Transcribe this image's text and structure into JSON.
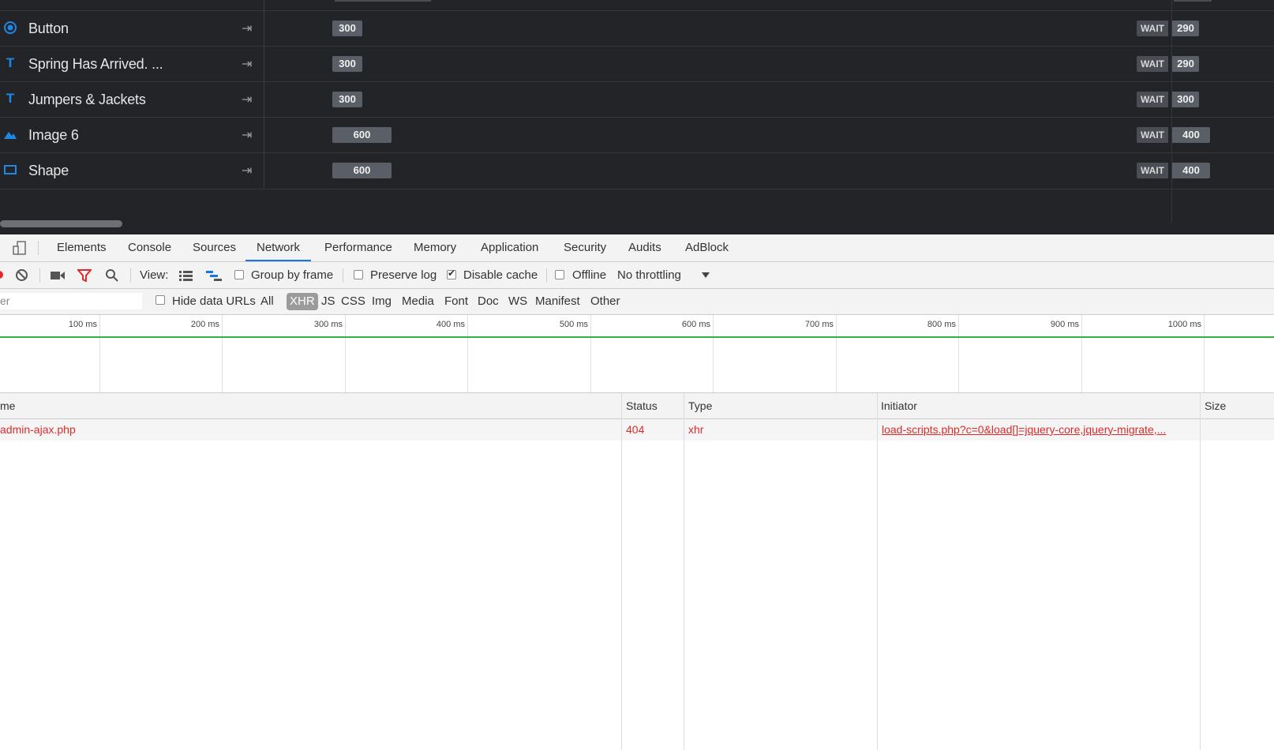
{
  "timeline": {
    "layers": [
      {
        "icon": "radio-icon",
        "name": "Button",
        "duration": "300",
        "wait_label": "WAIT",
        "wait_value": "290"
      },
      {
        "icon": "text-icon",
        "name": "Spring Has Arrived. ...",
        "duration": "300",
        "wait_label": "WAIT",
        "wait_value": "290"
      },
      {
        "icon": "text-icon",
        "name": "Jumpers & Jackets",
        "duration": "300",
        "wait_label": "WAIT",
        "wait_value": "300"
      },
      {
        "icon": "image-icon",
        "name": "Image 6",
        "duration": "600",
        "wait_label": "WAIT",
        "wait_value": "400"
      },
      {
        "icon": "shape-icon",
        "name": "Shape",
        "duration": "600",
        "wait_label": "WAIT",
        "wait_value": "400"
      }
    ],
    "text_glyph": "T",
    "arrow_glyph": "⇥"
  },
  "devtools": {
    "tabs": [
      "Elements",
      "Console",
      "Sources",
      "Network",
      "Performance",
      "Memory",
      "Application",
      "Security",
      "Audits",
      "AdBlock"
    ],
    "active_tab": "Network",
    "toolbar": {
      "view_label": "View:",
      "group_by_frame": "Group by frame",
      "preserve_log": "Preserve log",
      "disable_cache": "Disable cache",
      "disable_cache_checked": true,
      "offline": "Offline",
      "throttling": "No throttling"
    },
    "filter": {
      "input_value": "er",
      "hide_data_urls": "Hide data URLs",
      "types": [
        "All",
        "XHR",
        "JS",
        "CSS",
        "Img",
        "Media",
        "Font",
        "Doc",
        "WS",
        "Manifest",
        "Other"
      ],
      "active_type": "XHR"
    },
    "overview": {
      "ticks": [
        "100 ms",
        "200 ms",
        "300 ms",
        "400 ms",
        "500 ms",
        "600 ms",
        "700 ms",
        "800 ms",
        "900 ms",
        "1000 ms"
      ]
    },
    "table": {
      "columns": {
        "name": "me",
        "status": "Status",
        "type": "Type",
        "initiator": "Initiator",
        "size": "Size"
      },
      "rows": [
        {
          "name": "admin-ajax.php",
          "status": "404",
          "type": "xhr",
          "initiator": "load-scripts.php?c=0&load[]=jquery-core,jquery-migrate,..."
        }
      ]
    },
    "colors": {
      "accent": "#1a73e8",
      "error": "#e02a2a",
      "timeline_green": "#2fb24a",
      "layer_icon": "#1e88e5"
    }
  }
}
